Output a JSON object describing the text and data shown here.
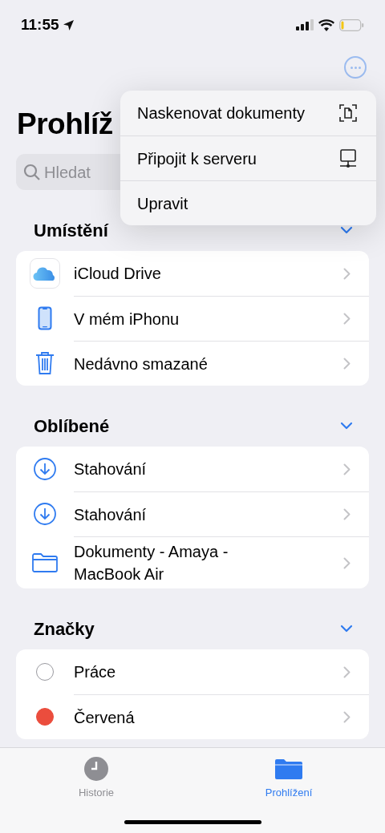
{
  "status_bar": {
    "time": "11:55"
  },
  "title": "Prohlíž",
  "search": {
    "placeholder": "Hledat"
  },
  "sections": [
    {
      "title": "Umístění",
      "expanded": true,
      "items": [
        {
          "label": "iCloud Drive",
          "kind": "cloud"
        },
        {
          "label": "V mém iPhonu",
          "kind": "phone"
        },
        {
          "label": "Nedávno smazané",
          "kind": "trash"
        }
      ]
    },
    {
      "title": "Oblíbené",
      "expanded": true,
      "items": [
        {
          "label": "Stahování",
          "kind": "download"
        },
        {
          "label": "Stahování",
          "kind": "download"
        },
        {
          "label": "Dokumenty - Amaya - MacBook Air",
          "kind": "folder"
        }
      ]
    },
    {
      "title": "Značky",
      "expanded": true,
      "items": [
        {
          "label": "Práce",
          "kind": "tag",
          "color": "#ffffff"
        },
        {
          "label": "Červená",
          "kind": "tag",
          "color": "#eb4d3d"
        }
      ]
    }
  ],
  "menu": [
    {
      "label": "Naskenovat dokumenty",
      "kind": "scan"
    },
    {
      "label": "Připojit k serveru",
      "kind": "server"
    },
    {
      "label": "Upravit",
      "kind": "plain"
    }
  ],
  "tabs": [
    {
      "label": "Historie",
      "kind": "clock",
      "selected": false
    },
    {
      "label": "Prohlížení",
      "kind": "folder",
      "selected": true
    }
  ]
}
